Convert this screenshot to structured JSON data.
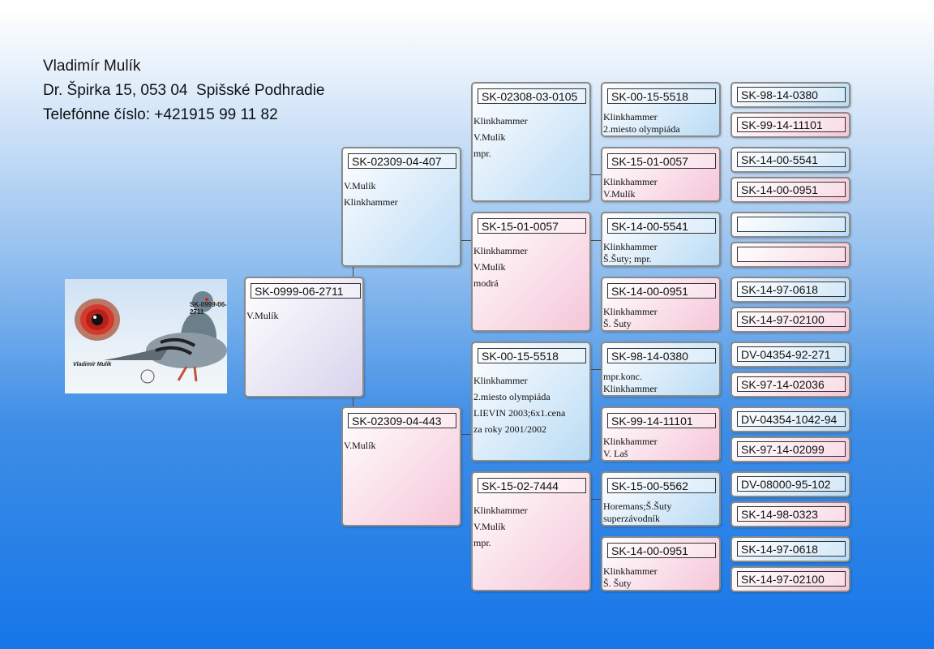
{
  "owner": {
    "name": "Vladimír Mulík",
    "address": "Dr. Špirka 15, 053 04  Spišské Podhradie",
    "phone": "Telefónne číslo: +421915 99 11 82"
  },
  "photo": {
    "ring": "SK-0999-06-2711",
    "symbol": "♀",
    "name": "Vladimír Mulík"
  },
  "subject": {
    "ring": "SK-0999-06-2711",
    "notes": [
      "V.Mulík"
    ]
  },
  "parents": [
    {
      "ring": "SK-02309-04-407",
      "notes": [
        "V.Mulík",
        "Klinkhammer"
      ]
    },
    {
      "ring": "SK-02309-04-443",
      "notes": [
        "V.Mulík"
      ]
    }
  ],
  "grandparents": [
    {
      "ring": "SK-02308-03-0105",
      "notes": [
        "Klinkhammer",
        "V.Mulík",
        "mpr."
      ]
    },
    {
      "ring": "SK-15-01-0057",
      "notes": [
        "Klinkhammer",
        "V.Mulík",
        "modrá"
      ]
    },
    {
      "ring": "SK-00-15-5518",
      "notes": [
        "Klinkhammer",
        "2.miesto olympiáda",
        "LIEVIN 2003;6x1.cena",
        "za roky 2001/2002"
      ]
    },
    {
      "ring": "SK-15-02-7444",
      "notes": [
        "Klinkhammer",
        "V.Mulík",
        "mpr."
      ]
    }
  ],
  "great_grandparents": [
    {
      "ring": "SK-00-15-5518",
      "notes": [
        "Klinkhammer",
        "2.miesto olympiáda"
      ]
    },
    {
      "ring": "SK-15-01-0057",
      "notes": [
        "Klinkhammer",
        "V.Mulík"
      ]
    },
    {
      "ring": "SK-14-00-5541",
      "notes": [
        "Klinkhammer",
        "Š.Šuty; mpr."
      ]
    },
    {
      "ring": "SK-14-00-0951",
      "notes": [
        "Klinkhammer",
        "Š. Šuty"
      ]
    },
    {
      "ring": "SK-98-14-0380",
      "notes": [
        "mpr.konc.",
        "Klinkhammer"
      ]
    },
    {
      "ring": "SK-99-14-11101",
      "notes": [
        "Klinkhammer",
        "V. Laš"
      ]
    },
    {
      "ring": "SK-15-00-5562",
      "notes": [
        "Horemans;Š.Šuty",
        "superzávodník"
      ]
    },
    {
      "ring": "SK-14-00-0951",
      "notes": [
        "Klinkhammer",
        "Š. Šuty"
      ]
    }
  ],
  "gen5": [
    "SK-98-14-0380",
    "SK-99-14-11101",
    "SK-14-00-5541",
    "SK-14-00-0951",
    "",
    "",
    "SK-14-97-0618",
    "SK-14-97-02100",
    "DV-04354-92-271",
    "SK-97-14-02036",
    "DV-04354-1042-94",
    "SK-97-14-02099",
    "DV-08000-95-102",
    "SK-14-98-0323",
    "SK-14-97-0618",
    "SK-14-97-02100"
  ]
}
